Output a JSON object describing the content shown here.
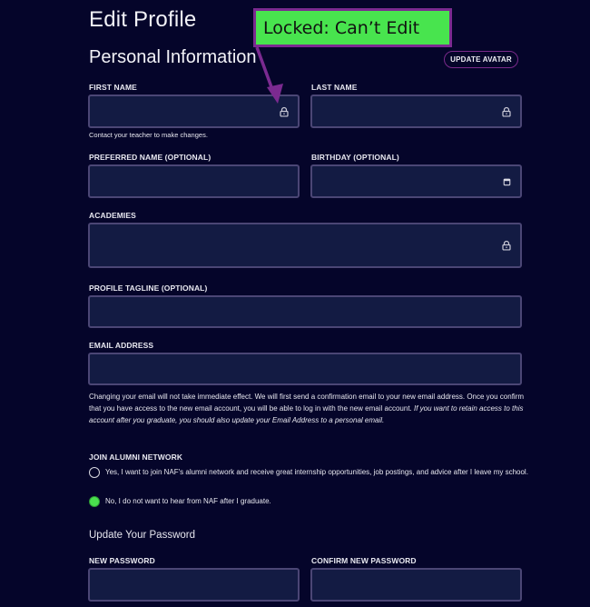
{
  "page": {
    "title": "Edit Profile",
    "section_title": "Personal Information",
    "update_avatar_label": "UPDATE AVATAR"
  },
  "annotation": {
    "callout_text": "Locked: Can’t Edit",
    "callout_bg": "#48e44e",
    "callout_border": "#7b2a90"
  },
  "fields": {
    "first_name": {
      "label": "FIRST NAME",
      "value": "",
      "icon": "lock-icon",
      "hint": "Contact your teacher to make changes."
    },
    "last_name": {
      "label": "LAST NAME",
      "value": "",
      "icon": "lock-icon"
    },
    "preferred_name": {
      "label": "PREFERRED NAME (OPTIONAL)",
      "value": ""
    },
    "birthday": {
      "label": "BIRTHDAY (OPTIONAL)",
      "value": "",
      "icon": "calendar-icon"
    },
    "academies": {
      "label": "ACADEMIES",
      "value": "",
      "icon": "lock-icon"
    },
    "profile_tagline": {
      "label": "PROFILE TAGLINE (OPTIONAL)",
      "value": ""
    },
    "email_address": {
      "label": "EMAIL ADDRESS",
      "value": ""
    }
  },
  "email_notice": {
    "text": "Changing your email will not take immediate effect. We will first send a confirmation email to your new email address. Once you confirm that you have access to the new email account, you will be able to log in with the new email account. ",
    "italic_text": "If you want to retain access to this account after you graduate, you should also update your Email Address to a personal email."
  },
  "alumni": {
    "label": "JOIN ALUMNI NETWORK",
    "options": [
      {
        "label": "Yes, I want to join NAF's alumni network and receive great internship opportunities, job postings, and advice after I leave my school.",
        "selected": false
      },
      {
        "label": "No, I do not want to hear from NAF after I graduate.",
        "selected": true
      }
    ]
  },
  "password": {
    "title": "Update Your Password",
    "new_label": "NEW PASSWORD",
    "new_value": "",
    "confirm_label": "CONFIRM NEW PASSWORD",
    "confirm_value": ""
  },
  "colors": {
    "background": "#05052a",
    "field_bg": "#131b43",
    "field_border": "#4b4675",
    "accent_purple": "#7b2a90",
    "radio_selected": "#4ae04e"
  }
}
